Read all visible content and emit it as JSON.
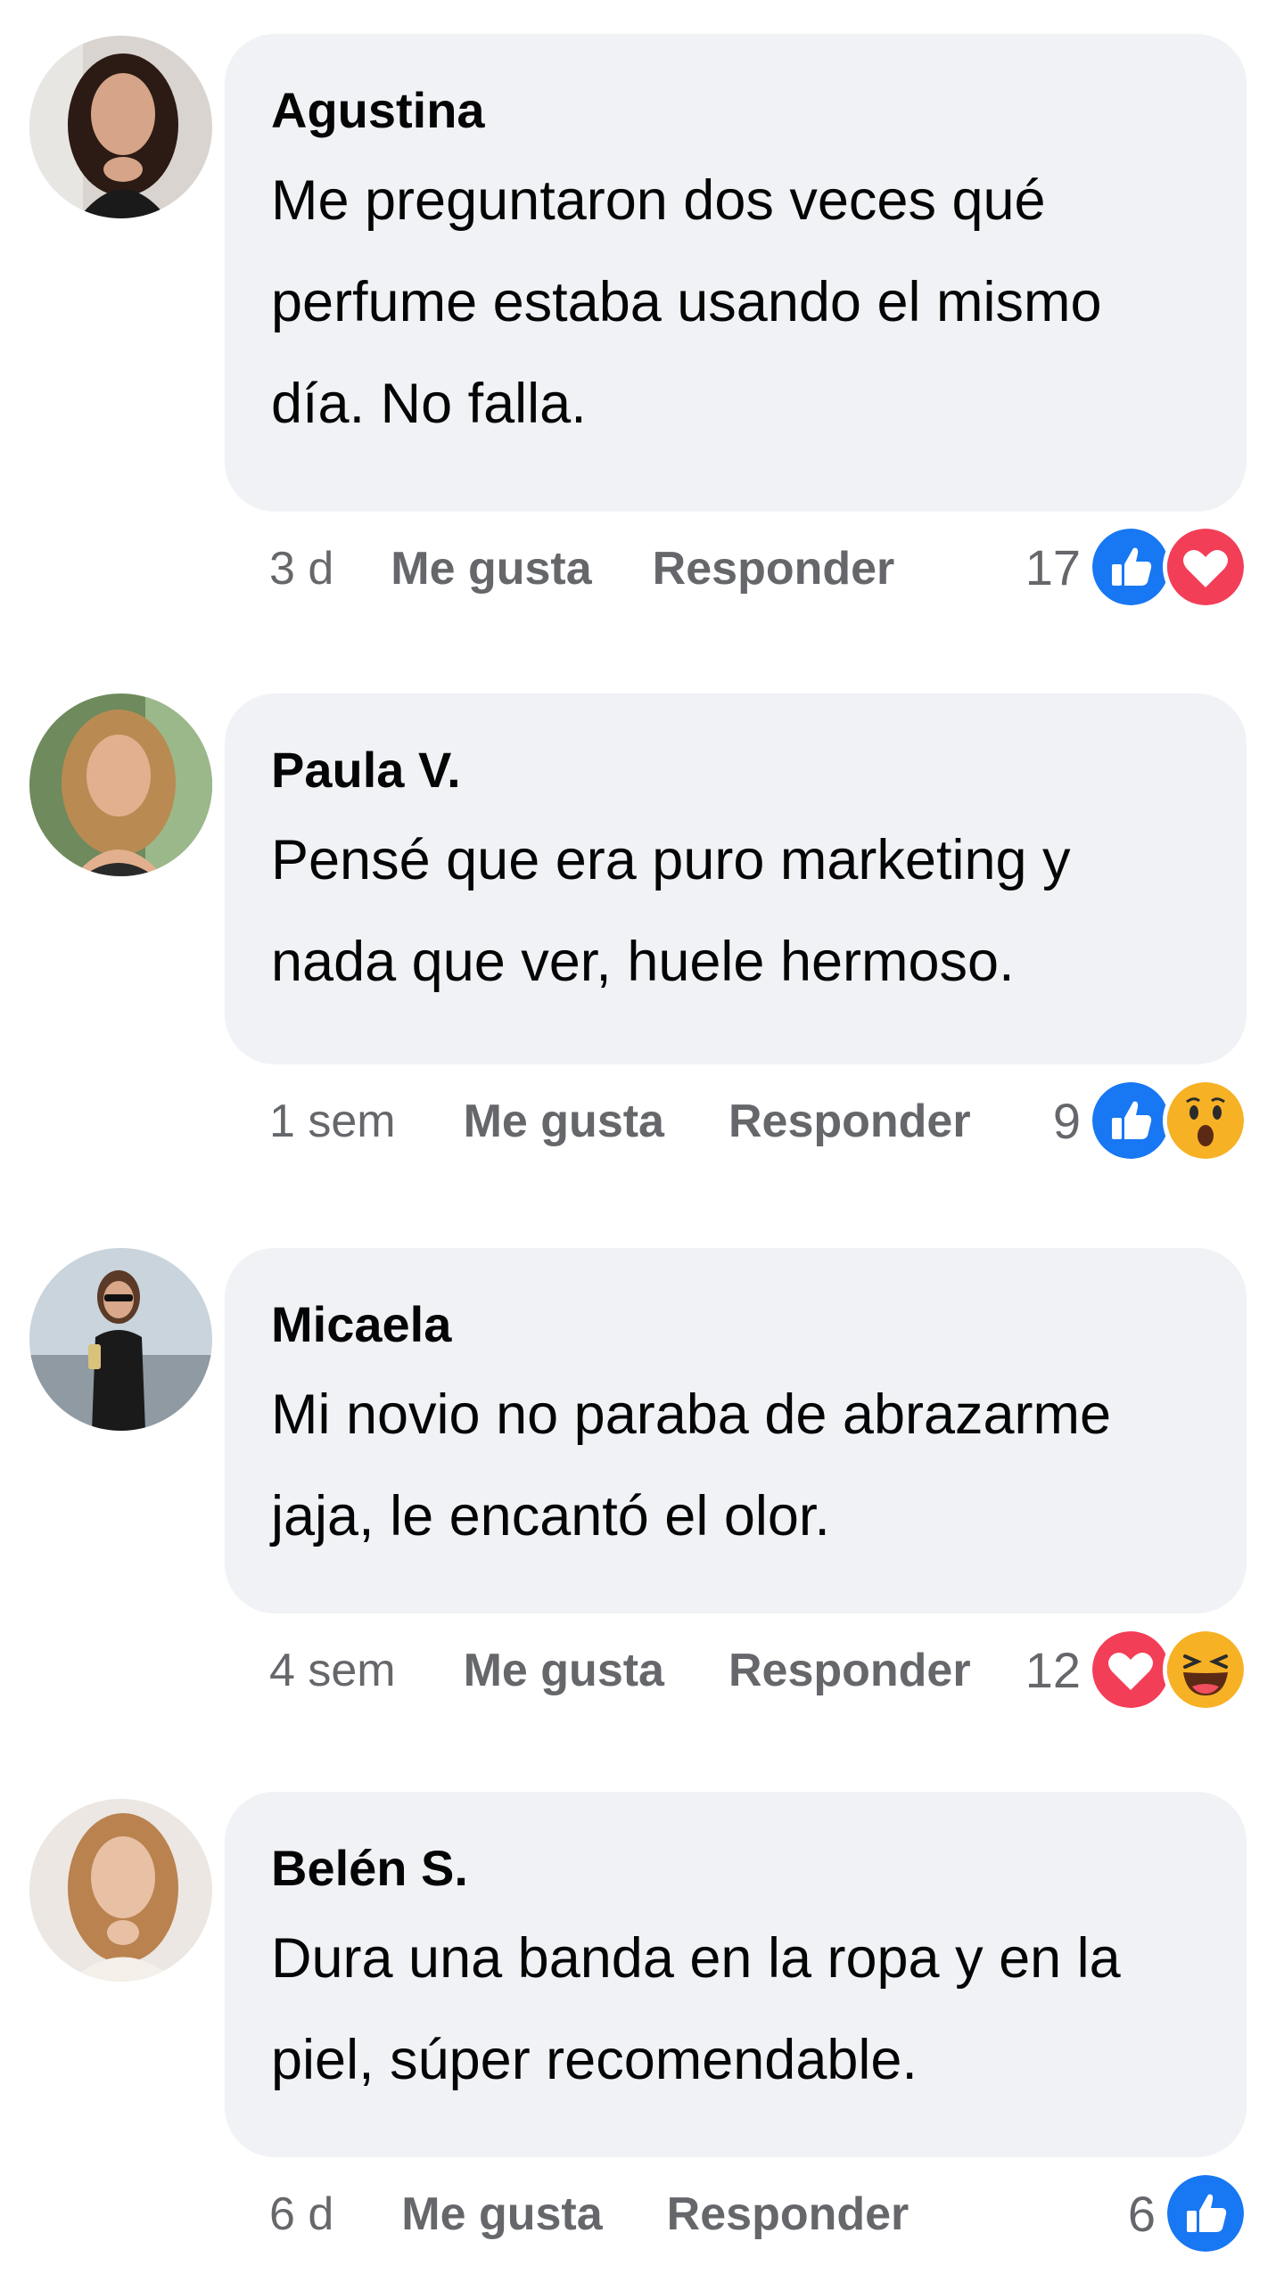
{
  "colors": {
    "bubble_bg": "#f0f2f5",
    "meta_text": "#65676b",
    "like_blue": "#1877f2",
    "love_red": "#f33e58",
    "emoji_yellow": "#f7b125"
  },
  "comments": [
    {
      "author": "Agustina",
      "text": "Me preguntaron dos veces qué perfume estaba usando el mismo día. No falla.",
      "time": "3 d",
      "like_label": "Me gusta",
      "reply_label": "Responder",
      "reaction_count": "17",
      "reactions": [
        "like-icon",
        "love-icon"
      ]
    },
    {
      "author": "Paula V.",
      "text": "Pensé que era puro marketing y nada que ver, huele hermoso.",
      "time": "1 sem",
      "like_label": "Me gusta",
      "reply_label": "Responder",
      "reaction_count": "9",
      "reactions": [
        "like-icon",
        "wow-icon"
      ]
    },
    {
      "author": "Micaela",
      "text": "Mi novio no paraba de abrazarme jaja, le encantó el olor.",
      "time": "4 sem",
      "like_label": "Me gusta",
      "reply_label": "Responder",
      "reaction_count": "12",
      "reactions": [
        "love-icon",
        "haha-icon"
      ]
    },
    {
      "author": "Belén S.",
      "text": "Dura una banda en la ropa y en la piel, súper recomendable.",
      "time": "6 d",
      "like_label": "Me gusta",
      "reply_label": "Responder",
      "reaction_count": "6",
      "reactions": [
        "like-icon"
      ]
    }
  ]
}
